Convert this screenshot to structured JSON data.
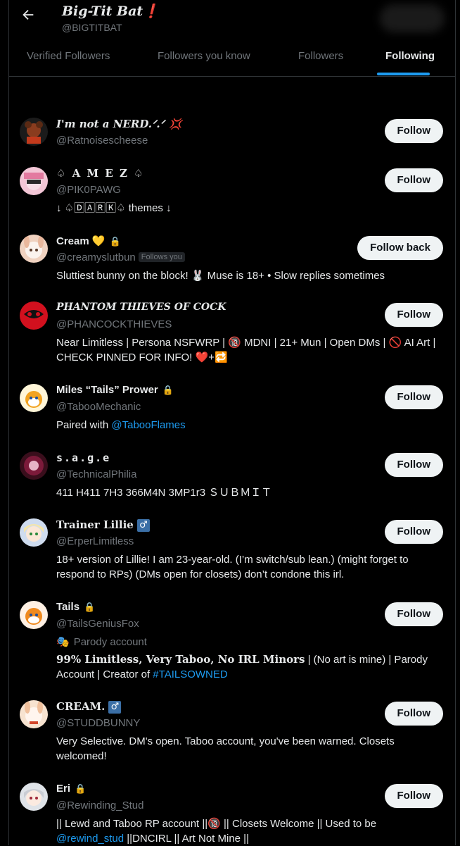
{
  "header": {
    "title": "Big-Tit Bat❗",
    "handle": "@BIGTITBAT"
  },
  "tabs": [
    {
      "label": "Verified Followers"
    },
    {
      "label": "Followers you know"
    },
    {
      "label": "Followers"
    },
    {
      "label": "Following"
    }
  ],
  "colors": {
    "accent": "#1d9bf0",
    "background": "#000000",
    "muted": "#71767b"
  },
  "users": [
    {
      "name": "I'm not a NERD.ᐟ.ᐟ",
      "handle": "@Ratnoisescheese",
      "bio": "",
      "button": "Follow",
      "extra": "💢"
    },
    {
      "name": "♤ A M E Z ♤",
      "handle": "@PIK0PAWG",
      "bio": "↓ ♤🄳🄰🅁🄺♤ themes ↓",
      "button": "Follow"
    },
    {
      "name": "Cream 💛",
      "handle": "@creamyslutbun",
      "follows_you": "Follows you",
      "bio": "Sluttiest bunny on the block! 🐰 Muse is 18+ • Slow replies sometimes",
      "button": "Follow back"
    },
    {
      "name": "PHANTOM THIEVES OF COCK",
      "handle": "@PHANCOCKTHIEVES",
      "bio": "Near Limitless | Persona NSFWRP | 🔞 MDNI | 21+ Mun | Open DMs | 🚫 AI Art | CHECK PINNED FOR INFO! ❤️+🔁",
      "button": "Follow"
    },
    {
      "name": "Miles “Tails” Prower",
      "handle": "@TabooMechanic",
      "bio": "Paired with ",
      "bio_link": "@TabooFlames",
      "button": "Follow"
    },
    {
      "name": "s.a.g.e",
      "handle": "@TechnicalPhilia",
      "bio": "411 H411 7H3 366M4N 3MP1r3 ＳＵＢＭＩＴ",
      "button": "Follow"
    },
    {
      "name": "Trainer Lillie",
      "handle": "@ErperLimitless",
      "bio": "18+ version of Lillie! I am 23-year-old. (I’m switch/sub lean.) (might forget to respond to RPs) (DMs open for closets) don’t condone this irl.",
      "button": "Follow",
      "badge": "♂"
    },
    {
      "name": "Tails",
      "handle": "@TailsGeniusFox",
      "parody": "Parody account",
      "bio_bold": "99% Limitless, Very Taboo, No IRL Minors",
      "bio": " | (No art is mine) | Parody Account | Creator of ",
      "bio_link": "#TAILSOWNED",
      "button": "Follow"
    },
    {
      "name": "CREAM.",
      "handle": "@STUDDBUNNY",
      "bio": "Very Selective. DM's open. Taboo account, you've been warned. Closets welcomed!",
      "button": "Follow",
      "badge": "♂"
    },
    {
      "name": "Eri",
      "handle": "@Rewinding_Stud",
      "bio": "|| Lewd and Taboo RP account ||🔞 || Closets Welcome || Used to be ",
      "bio_link": "@rewind_stud",
      "bio_tail": " ||DNCIRL || Art Not Mine ||",
      "button": "Follow"
    }
  ]
}
